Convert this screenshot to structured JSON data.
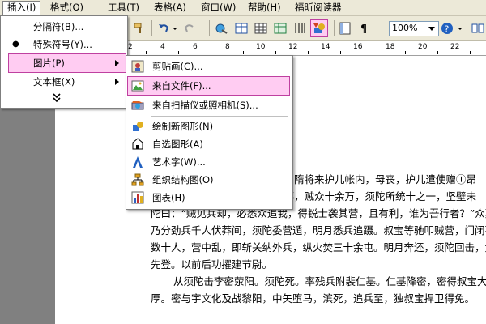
{
  "menubar": {
    "items": [
      "插入(I)",
      "格式(O)",
      "工具(T)",
      "表格(A)",
      "窗口(W)",
      "帮助(H)",
      "福昕阅读器"
    ]
  },
  "toolbar": {
    "zoom": "100%"
  },
  "ruler": {
    "numbers": [
      "2",
      "4",
      "6",
      "8",
      "10",
      "12",
      "14",
      "16",
      "18",
      "20",
      "22"
    ]
  },
  "insert_menu": {
    "items": [
      {
        "label": "分隔符(B)..."
      },
      {
        "label": "特殊符号(Y)..."
      },
      {
        "label": "图片(P)"
      },
      {
        "label": "文本框(X)"
      }
    ]
  },
  "picture_submenu": {
    "items": [
      {
        "label": "剪贴画(C)...",
        "icon": "clipart-icon"
      },
      {
        "label": "来自文件(F)...",
        "icon": "from-file-icon"
      },
      {
        "label": "来自扫描仪或照相机(S)...",
        "icon": "scanner-camera-icon"
      },
      {
        "label": "绘制新图形(N)",
        "icon": "new-drawing-icon"
      },
      {
        "label": "自选图形(A)",
        "icon": "autoshapes-icon"
      },
      {
        "label": "艺术字(W)...",
        "icon": "wordart-icon"
      },
      {
        "label": "组织结构图(O)",
        "icon": "org-chart-icon"
      },
      {
        "label": "图表(H)",
        "icon": "chart-icon"
      }
    ]
  },
  "document": {
    "lines": [
      "始为隋将来护儿帐内，母丧，护儿遣使赠①昂",
      "下邳，贼众十余万，须陀所统十之一，坚壁未",
      "陀曰：“贼见兵却，必悉众追我，得锐士袭其营，且有利，谁为吾行者？”众莫",
      "乃分劲兵千人伏莽间，须陀委营遁，明月悉兵追蹑。叔宝等驰叩贼营，门闭不得",
      "数十人，营中乱，即斩关纳外兵，纵火焚三十余屯。明月奔还，须陀回击，大破",
      "先登。以前后功擢建节尉。",
      "从须陀击李密荥阳。须陀死。率残兵附裴仁基。仁基降密，密得叔宝大喜",
      "厚。密与宇文化及战黎阳，中矢堕马，滨死，追兵至，独叔宝捍卫得免。"
    ]
  },
  "colors": {
    "highlight": "#ffccf2",
    "highlight_border": "#bf40a0",
    "chrome": "#ece9d8"
  }
}
